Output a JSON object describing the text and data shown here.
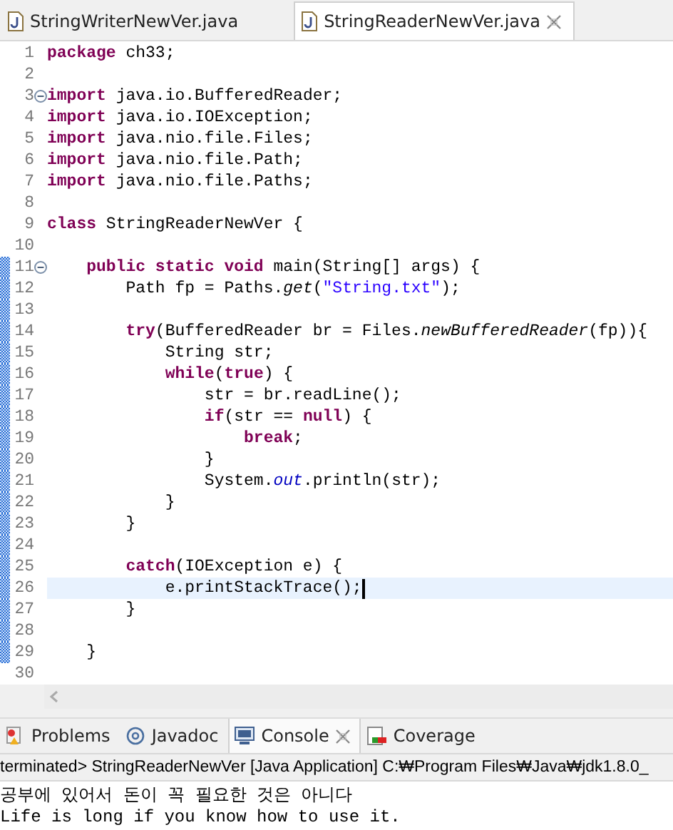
{
  "editor": {
    "tabs": [
      {
        "label": "StringWriterNewVer.java",
        "selected": false
      },
      {
        "label": "StringReaderNewVer.java",
        "selected": true
      }
    ],
    "lines": [
      {
        "number": "1",
        "fold": false,
        "changed": false,
        "current": false,
        "tokens": [
          {
            "kind": "keyword",
            "text": "package"
          },
          {
            "kind": "plain",
            "text": " ch33;"
          }
        ]
      },
      {
        "number": "2",
        "fold": false,
        "changed": false,
        "current": false
      },
      {
        "number": "3",
        "fold": true,
        "changed": false,
        "current": false,
        "tokens": [
          {
            "kind": "keyword",
            "text": "import"
          },
          {
            "kind": "plain",
            "text": " java.io.BufferedReader;"
          }
        ]
      },
      {
        "number": "4",
        "fold": false,
        "changed": false,
        "current": false,
        "tokens": [
          {
            "kind": "keyword",
            "text": "import"
          },
          {
            "kind": "plain",
            "text": " java.io.IOException;"
          }
        ]
      },
      {
        "number": "5",
        "fold": false,
        "changed": false,
        "current": false,
        "tokens": [
          {
            "kind": "keyword",
            "text": "import"
          },
          {
            "kind": "plain",
            "text": " java.nio.file.Files;"
          }
        ]
      },
      {
        "number": "6",
        "fold": false,
        "changed": false,
        "current": false,
        "tokens": [
          {
            "kind": "keyword",
            "text": "import"
          },
          {
            "kind": "plain",
            "text": " java.nio.file.Path;"
          }
        ]
      },
      {
        "number": "7",
        "fold": false,
        "changed": false,
        "current": false,
        "tokens": [
          {
            "kind": "keyword",
            "text": "import"
          },
          {
            "kind": "plain",
            "text": " java.nio.file.Paths;"
          }
        ]
      },
      {
        "number": "8",
        "fold": false,
        "changed": false,
        "current": false
      },
      {
        "number": "9",
        "fold": false,
        "changed": false,
        "current": false,
        "tokens": [
          {
            "kind": "keyword",
            "text": "class"
          },
          {
            "kind": "plain",
            "text": " StringReaderNewVer {"
          }
        ]
      },
      {
        "number": "10",
        "fold": false,
        "changed": false,
        "current": false
      },
      {
        "number": "11",
        "fold": true,
        "changed": true,
        "current": false,
        "tokens": [
          {
            "kind": "keyword",
            "text": "    public static void"
          },
          {
            "kind": "plain",
            "text": " main(String[] args) {"
          }
        ]
      },
      {
        "number": "12",
        "fold": false,
        "changed": true,
        "current": false,
        "tokens": [
          {
            "kind": "plain",
            "text": "        Path fp = Paths."
          },
          {
            "kind": "static-method",
            "text": "get"
          },
          {
            "kind": "plain",
            "text": "("
          },
          {
            "kind": "string",
            "text": "\"String.txt\""
          },
          {
            "kind": "plain",
            "text": ");"
          }
        ]
      },
      {
        "number": "13",
        "fold": false,
        "changed": true,
        "current": false
      },
      {
        "number": "14",
        "fold": false,
        "changed": true,
        "current": false,
        "tokens": [
          {
            "kind": "keyword",
            "text": "        try"
          },
          {
            "kind": "plain",
            "text": "(BufferedReader br = Files."
          },
          {
            "kind": "static-method",
            "text": "newBufferedReader"
          },
          {
            "kind": "plain",
            "text": "(fp)){"
          }
        ]
      },
      {
        "number": "15",
        "fold": false,
        "changed": true,
        "current": false,
        "tokens": [
          {
            "kind": "plain",
            "text": "            String str;"
          }
        ]
      },
      {
        "number": "16",
        "fold": false,
        "changed": true,
        "current": false,
        "tokens": [
          {
            "kind": "keyword",
            "text": "            while"
          },
          {
            "kind": "plain",
            "text": "("
          },
          {
            "kind": "keyword",
            "text": "true"
          },
          {
            "kind": "plain",
            "text": ") {"
          }
        ]
      },
      {
        "number": "17",
        "fold": false,
        "changed": true,
        "current": false,
        "tokens": [
          {
            "kind": "plain",
            "text": "                str = br.readLine();"
          }
        ]
      },
      {
        "number": "18",
        "fold": false,
        "changed": true,
        "current": false,
        "tokens": [
          {
            "kind": "keyword",
            "text": "                if"
          },
          {
            "kind": "plain",
            "text": "(str == "
          },
          {
            "kind": "keyword",
            "text": "null"
          },
          {
            "kind": "plain",
            "text": ") {"
          }
        ]
      },
      {
        "number": "19",
        "fold": false,
        "changed": true,
        "current": false,
        "tokens": [
          {
            "kind": "keyword",
            "text": "                    break"
          },
          {
            "kind": "plain",
            "text": ";"
          }
        ]
      },
      {
        "number": "20",
        "fold": false,
        "changed": true,
        "current": false,
        "tokens": [
          {
            "kind": "plain",
            "text": "                }"
          }
        ]
      },
      {
        "number": "21",
        "fold": false,
        "changed": true,
        "current": false,
        "tokens": [
          {
            "kind": "plain",
            "text": "                System."
          },
          {
            "kind": "static-field",
            "text": "out"
          },
          {
            "kind": "plain",
            "text": ".println(str);"
          }
        ]
      },
      {
        "number": "22",
        "fold": false,
        "changed": true,
        "current": false,
        "tokens": [
          {
            "kind": "plain",
            "text": "            }"
          }
        ]
      },
      {
        "number": "23",
        "fold": false,
        "changed": true,
        "current": false,
        "tokens": [
          {
            "kind": "plain",
            "text": "        }"
          }
        ]
      },
      {
        "number": "24",
        "fold": false,
        "changed": true,
        "current": false
      },
      {
        "number": "25",
        "fold": false,
        "changed": true,
        "current": false,
        "tokens": [
          {
            "kind": "keyword",
            "text": "        catch"
          },
          {
            "kind": "plain",
            "text": "(IOException e) {"
          }
        ]
      },
      {
        "number": "26",
        "fold": false,
        "changed": true,
        "current": true,
        "tokens": [
          {
            "kind": "plain",
            "text": "            e.printStackTrace();"
          }
        ]
      },
      {
        "number": "27",
        "fold": false,
        "changed": true,
        "current": false,
        "tokens": [
          {
            "kind": "plain",
            "text": "        }"
          }
        ]
      },
      {
        "number": "28",
        "fold": false,
        "changed": true,
        "current": false
      },
      {
        "number": "29",
        "fold": false,
        "changed": true,
        "current": false,
        "tokens": [
          {
            "kind": "plain",
            "text": "    }"
          }
        ]
      },
      {
        "number": "30",
        "fold": false,
        "changed": false,
        "current": false
      }
    ]
  },
  "panel": {
    "tabs": [
      {
        "label": "Problems",
        "kind": "problems",
        "selected": false
      },
      {
        "label": "Javadoc",
        "kind": "javadoc",
        "selected": false
      },
      {
        "label": "Console",
        "kind": "console",
        "selected": true
      },
      {
        "label": "Coverage",
        "kind": "coverage",
        "selected": false
      }
    ],
    "console": {
      "header": "terminated> StringReaderNewVer [Java Application] C:₩Program Files₩Java₩jdk1.8.0_",
      "output": [
        "공부에 있어서 돈이 꼭 필요한 것은 아니다",
        "Life is long if you know how to use it."
      ]
    }
  }
}
